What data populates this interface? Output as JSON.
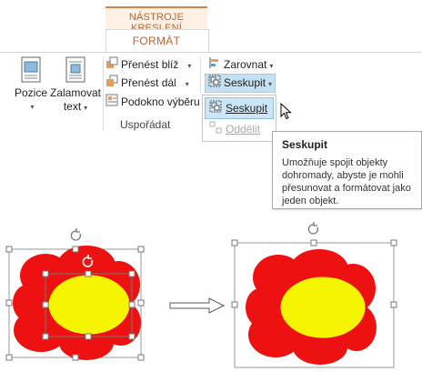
{
  "ribbon": {
    "context_tab": "NÁSTROJE KRESLENÍ",
    "active_tab": "FORMÁT",
    "position_label": "Pozice",
    "wrap_label_line1": "Zalamovat",
    "wrap_label_line2": "text",
    "bring_forward": "Přenést blíž",
    "send_backward": "Přenést dál",
    "selection_pane": "Podokno výběru",
    "align": "Zarovnat",
    "group_btn": "Seskupit",
    "group_name": "Uspořádat",
    "accent_color": "#c0622b"
  },
  "dropdown": {
    "items": [
      {
        "label": "Seskupit",
        "state": "hover"
      },
      {
        "label": "Oddělit",
        "state": "disabled"
      }
    ]
  },
  "tooltip": {
    "title": "Seskupit",
    "body": "Umožňuje spojit objekty dohromady, abyste je mohli přesunovat a formátovat jako jeden objekt."
  },
  "illustration": {
    "petal_color": "#ee1111",
    "center_color": "#f5f500",
    "arrow": "right-arrow-icon"
  }
}
